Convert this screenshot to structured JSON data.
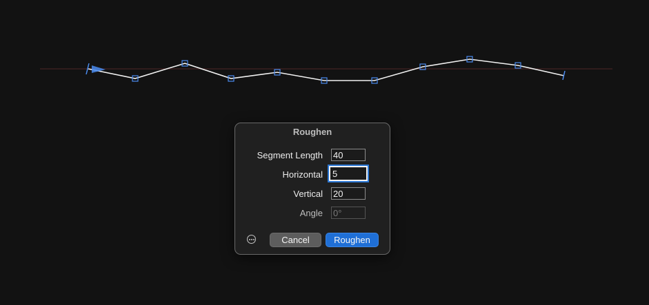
{
  "dialog": {
    "title": "Roughen",
    "fields": [
      {
        "label": "Segment Length",
        "value": "40",
        "enabled": true,
        "focused": false
      },
      {
        "label": "Horizontal",
        "value": "5",
        "enabled": true,
        "focused": true
      },
      {
        "label": "Vertical",
        "value": "20",
        "enabled": true,
        "focused": false
      },
      {
        "label": "Angle",
        "value": "0°",
        "enabled": false,
        "focused": false
      }
    ],
    "cancel_label": "Cancel",
    "confirm_label": "Roughen"
  },
  "colors": {
    "background": "#121212",
    "guide_line": "#3a2020",
    "path_stroke": "#ffffff",
    "handle_stroke": "#4a8cf0",
    "accent": "#1f6fd6"
  }
}
